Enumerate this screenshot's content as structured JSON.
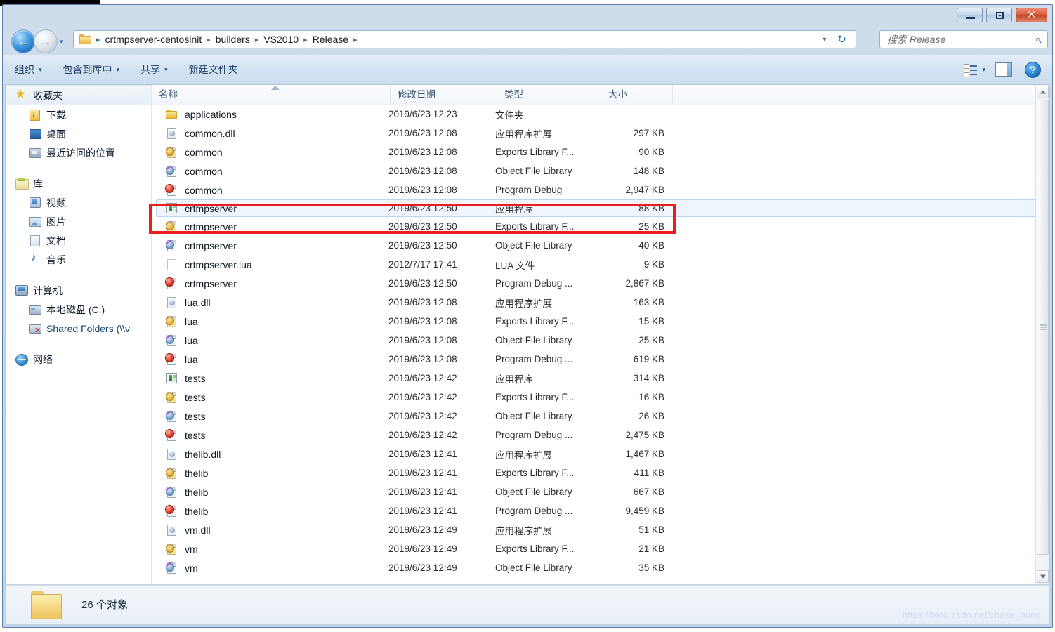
{
  "window": {
    "controls": {
      "minimize": "–",
      "maximize": "❐",
      "close": "✕"
    }
  },
  "address": {
    "back_label": "←",
    "forward_label": "→",
    "history_label": "▾",
    "refresh_label": "↻",
    "dropdown_label": "▾",
    "breadcrumbs": [
      "crtmpserver-centosinit",
      "builders",
      "VS2010",
      "Release"
    ],
    "separator": "▸"
  },
  "search": {
    "placeholder": "搜索 Release",
    "value": "",
    "icon": "search-icon"
  },
  "toolbar": {
    "items": [
      {
        "label": "组织",
        "caret": "▾"
      },
      {
        "label": "包含到库中",
        "caret": "▾"
      },
      {
        "label": "共享",
        "caret": "▾"
      },
      {
        "label": "新建文件夹",
        "caret": ""
      }
    ],
    "view_caret": "▾",
    "help_label": "?"
  },
  "sidebar": {
    "groups": [
      {
        "items": [
          {
            "label": "收藏夹",
            "icon": "star-icon",
            "level": 0,
            "selected": true
          },
          {
            "label": "下载",
            "icon": "downloads-icon",
            "level": 1
          },
          {
            "label": "桌面",
            "icon": "desktop-icon",
            "level": 1
          },
          {
            "label": "最近访问的位置",
            "icon": "recent-places-icon",
            "level": 1
          }
        ]
      },
      {
        "items": [
          {
            "label": "库",
            "icon": "library-icon",
            "level": 0
          },
          {
            "label": "视频",
            "icon": "videos-icon",
            "level": 1
          },
          {
            "label": "图片",
            "icon": "pictures-icon",
            "level": 1
          },
          {
            "label": "文档",
            "icon": "documents-icon",
            "level": 1
          },
          {
            "label": "音乐",
            "icon": "music-icon",
            "level": 1
          }
        ]
      },
      {
        "items": [
          {
            "label": "计算机",
            "icon": "computer-icon",
            "level": 0
          },
          {
            "label": "本地磁盘 (C:)",
            "icon": "harddisk-icon",
            "level": 1
          },
          {
            "label": "Shared Folders (\\\\v",
            "icon": "network-drive-disconnected-icon",
            "level": 1
          }
        ]
      },
      {
        "items": [
          {
            "label": "网络",
            "icon": "network-icon",
            "level": 0
          }
        ]
      }
    ]
  },
  "filelist": {
    "columns": [
      {
        "key": "name",
        "label": "名称"
      },
      {
        "key": "date",
        "label": "修改日期"
      },
      {
        "key": "type",
        "label": "类型"
      },
      {
        "key": "size",
        "label": "大小"
      }
    ],
    "sort_column": "名称",
    "sort_direction": "asc",
    "rows": [
      {
        "name": "applications",
        "date": "2019/6/23 12:23",
        "type": "文件夹",
        "size": "",
        "icon": "folder-icon",
        "selected": false
      },
      {
        "name": "common.dll",
        "date": "2019/6/23 12:08",
        "type": "应用程序扩展",
        "size": "297 KB",
        "icon": "dll-icon",
        "selected": false
      },
      {
        "name": "common",
        "date": "2019/6/23 12:08",
        "type": "Exports Library F...",
        "size": "90 KB",
        "icon": "exports-library-icon",
        "selected": false
      },
      {
        "name": "common",
        "date": "2019/6/23 12:08",
        "type": "Object File Library",
        "size": "148 KB",
        "icon": "object-file-library-icon",
        "selected": false
      },
      {
        "name": "common",
        "date": "2019/6/23 12:08",
        "type": "Program Debug",
        "size": "2,947 KB",
        "icon": "program-debug-icon",
        "selected": false
      },
      {
        "name": "crtmpserver",
        "date": "2019/6/23 12:50",
        "type": "应用程序",
        "size": "88 KB",
        "icon": "application-icon",
        "selected": true
      },
      {
        "name": "crtmpserver",
        "date": "2019/6/23 12:50",
        "type": "Exports Library F...",
        "size": "25 KB",
        "icon": "exports-library-icon",
        "selected": false
      },
      {
        "name": "crtmpserver",
        "date": "2019/6/23 12:50",
        "type": "Object File Library",
        "size": "40 KB",
        "icon": "object-file-library-icon",
        "selected": false
      },
      {
        "name": "crtmpserver.lua",
        "date": "2012/7/17 17:41",
        "type": "LUA 文件",
        "size": "9 KB",
        "icon": "plain-file-icon",
        "selected": false
      },
      {
        "name": "crtmpserver",
        "date": "2019/6/23 12:50",
        "type": "Program Debug ...",
        "size": "2,867 KB",
        "icon": "program-debug-icon",
        "selected": false
      },
      {
        "name": "lua.dll",
        "date": "2019/6/23 12:08",
        "type": "应用程序扩展",
        "size": "163 KB",
        "icon": "dll-icon",
        "selected": false
      },
      {
        "name": "lua",
        "date": "2019/6/23 12:08",
        "type": "Exports Library F...",
        "size": "15 KB",
        "icon": "exports-library-icon",
        "selected": false
      },
      {
        "name": "lua",
        "date": "2019/6/23 12:08",
        "type": "Object File Library",
        "size": "25 KB",
        "icon": "object-file-library-icon",
        "selected": false
      },
      {
        "name": "lua",
        "date": "2019/6/23 12:08",
        "type": "Program Debug ...",
        "size": "619 KB",
        "icon": "program-debug-icon",
        "selected": false
      },
      {
        "name": "tests",
        "date": "2019/6/23 12:42",
        "type": "应用程序",
        "size": "314 KB",
        "icon": "application-icon",
        "selected": false
      },
      {
        "name": "tests",
        "date": "2019/6/23 12:42",
        "type": "Exports Library F...",
        "size": "16 KB",
        "icon": "exports-library-icon",
        "selected": false
      },
      {
        "name": "tests",
        "date": "2019/6/23 12:42",
        "type": "Object File Library",
        "size": "26 KB",
        "icon": "object-file-library-icon",
        "selected": false
      },
      {
        "name": "tests",
        "date": "2019/6/23 12:42",
        "type": "Program Debug ...",
        "size": "2,475 KB",
        "icon": "program-debug-icon",
        "selected": false
      },
      {
        "name": "thelib.dll",
        "date": "2019/6/23 12:41",
        "type": "应用程序扩展",
        "size": "1,467 KB",
        "icon": "dll-icon",
        "selected": false
      },
      {
        "name": "thelib",
        "date": "2019/6/23 12:41",
        "type": "Exports Library F...",
        "size": "411 KB",
        "icon": "exports-library-icon",
        "selected": false
      },
      {
        "name": "thelib",
        "date": "2019/6/23 12:41",
        "type": "Object File Library",
        "size": "667 KB",
        "icon": "object-file-library-icon",
        "selected": false
      },
      {
        "name": "thelib",
        "date": "2019/6/23 12:41",
        "type": "Program Debug ...",
        "size": "9,459 KB",
        "icon": "program-debug-icon",
        "selected": false
      },
      {
        "name": "vm.dll",
        "date": "2019/6/23 12:49",
        "type": "应用程序扩展",
        "size": "51 KB",
        "icon": "dll-icon",
        "selected": false
      },
      {
        "name": "vm",
        "date": "2019/6/23 12:49",
        "type": "Exports Library F...",
        "size": "21 KB",
        "icon": "exports-library-icon",
        "selected": false
      },
      {
        "name": "vm",
        "date": "2019/6/23 12:49",
        "type": "Object File Library",
        "size": "35 KB",
        "icon": "object-file-library-icon",
        "selected": false
      }
    ]
  },
  "status": {
    "object_count": "26 个对象"
  },
  "watermark": {
    "text": "https://blog.csdn.net/chase_hung"
  },
  "annotation": {
    "color": "#ee1c1c",
    "target": "crtmpserver"
  },
  "colors": {
    "accent": "#2b6ca8",
    "selection": "#eef5fd",
    "annotation": "#ee1c1c",
    "chrome": "#cfdcec"
  }
}
